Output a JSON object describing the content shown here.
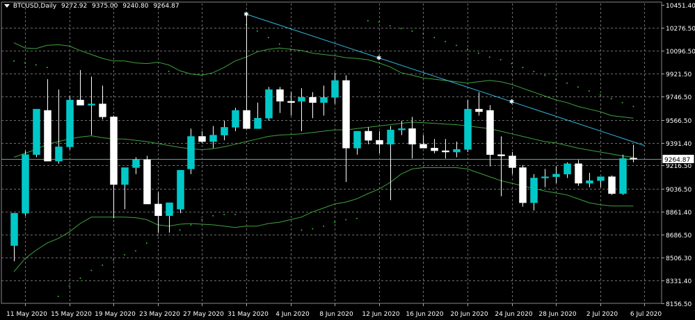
{
  "header": {
    "symbol": "BTCUSD,Daily",
    "open": "9272.92",
    "high": "9375.00",
    "low": "9240.80",
    "close": "9264.87"
  },
  "colors": {
    "background": "#000000",
    "bull_body": "#00c8c8",
    "bear_body": "#ffffff",
    "wick": "#ffffff",
    "band": "#3fa33f",
    "sar": "#33dd33",
    "trendline": "#2fb9e0",
    "grid": "#6f6f6f",
    "price_line": "#6f9f9f"
  },
  "chart_data": {
    "type": "candlestick",
    "ylim": [
      8156.5,
      10451.4
    ],
    "y_ticks": [
      "10451.40",
      "10276.50",
      "10096.50",
      "9921.50",
      "9746.50",
      "9566.50",
      "9391.40",
      "9216.50",
      "9036.50",
      "8861.40",
      "8686.50",
      "8506.30",
      "8331.40",
      "8156.50"
    ],
    "x_ticks": [
      "11 May 2020",
      "15 May 2020",
      "19 May 2020",
      "23 May 2020",
      "27 May 2020",
      "31 May 2020",
      "4 Jun 2020",
      "8 Jun 2020",
      "12 Jun 2020",
      "16 Jun 2020",
      "20 Jun 2020",
      "24 Jun 2020",
      "28 Jun 2020",
      "2 Jul 2020",
      "6 Jul 2020"
    ],
    "current_price": "9264.87",
    "candles": [
      {
        "date": "2020-05-10",
        "o": 8600,
        "h": 8780,
        "l": 8480,
        "c": 8850
      },
      {
        "date": "2020-05-11",
        "o": 8850,
        "h": 9330,
        "l": 8830,
        "c": 9300
      },
      {
        "date": "2020-05-12",
        "o": 9300,
        "h": 9600,
        "l": 9280,
        "c": 9650
      },
      {
        "date": "2020-05-13",
        "o": 9640,
        "h": 9880,
        "l": 9250,
        "c": 9250
      },
      {
        "date": "2020-05-14",
        "o": 9250,
        "h": 9800,
        "l": 9230,
        "c": 9360
      },
      {
        "date": "2020-05-15",
        "o": 9360,
        "h": 9750,
        "l": 9340,
        "c": 9720
      },
      {
        "date": "2020-05-16",
        "o": 9720,
        "h": 9950,
        "l": 9700,
        "c": 9680
      },
      {
        "date": "2020-05-17",
        "o": 9680,
        "h": 9900,
        "l": 9450,
        "c": 9690
      },
      {
        "date": "2020-05-18",
        "o": 9690,
        "h": 9830,
        "l": 9570,
        "c": 9590
      },
      {
        "date": "2020-05-19",
        "o": 9590,
        "h": 9600,
        "l": 8810,
        "c": 9070
      },
      {
        "date": "2020-05-20",
        "o": 9070,
        "h": 9200,
        "l": 8880,
        "c": 9200
      },
      {
        "date": "2020-05-21",
        "o": 9200,
        "h": 9280,
        "l": 9150,
        "c": 9260
      },
      {
        "date": "2020-05-22",
        "o": 9260,
        "h": 9290,
        "l": 8920,
        "c": 8920
      },
      {
        "date": "2020-05-23",
        "o": 8920,
        "h": 9010,
        "l": 8700,
        "c": 8830
      },
      {
        "date": "2020-05-24",
        "o": 8830,
        "h": 8920,
        "l": 8700,
        "c": 8930
      },
      {
        "date": "2020-05-25",
        "o": 8880,
        "h": 9180,
        "l": 8850,
        "c": 9180
      },
      {
        "date": "2020-05-26",
        "o": 9190,
        "h": 9500,
        "l": 9150,
        "c": 9440
      },
      {
        "date": "2020-05-27",
        "o": 9440,
        "h": 9480,
        "l": 9390,
        "c": 9400
      },
      {
        "date": "2020-05-28",
        "o": 9400,
        "h": 9520,
        "l": 9350,
        "c": 9450
      },
      {
        "date": "2020-05-29",
        "o": 9450,
        "h": 9560,
        "l": 9410,
        "c": 9510
      },
      {
        "date": "2020-05-30",
        "o": 9510,
        "h": 9660,
        "l": 9480,
        "c": 9640
      },
      {
        "date": "2020-05-31",
        "o": 9640,
        "h": 10380,
        "l": 9510,
        "c": 9500
      },
      {
        "date": "2020-06-01",
        "o": 9500,
        "h": 9700,
        "l": 9500,
        "c": 9580
      },
      {
        "date": "2020-06-02",
        "o": 9580,
        "h": 9820,
        "l": 9560,
        "c": 9800
      },
      {
        "date": "2020-06-03",
        "o": 9800,
        "h": 9820,
        "l": 9620,
        "c": 9710
      },
      {
        "date": "2020-06-04",
        "o": 9710,
        "h": 9780,
        "l": 9600,
        "c": 9700
      },
      {
        "date": "2020-06-05",
        "o": 9710,
        "h": 9810,
        "l": 9480,
        "c": 9740
      },
      {
        "date": "2020-06-06",
        "o": 9740,
        "h": 9780,
        "l": 9580,
        "c": 9700
      },
      {
        "date": "2020-06-07",
        "o": 9700,
        "h": 9830,
        "l": 9600,
        "c": 9740
      },
      {
        "date": "2020-06-08",
        "o": 9740,
        "h": 9930,
        "l": 9690,
        "c": 9870
      },
      {
        "date": "2020-06-09",
        "o": 9870,
        "h": 9910,
        "l": 9090,
        "c": 9350
      },
      {
        "date": "2020-06-10",
        "o": 9350,
        "h": 9450,
        "l": 9300,
        "c": 9480
      },
      {
        "date": "2020-06-11",
        "o": 9480,
        "h": 9510,
        "l": 9380,
        "c": 9410
      },
      {
        "date": "2020-06-12",
        "o": 9410,
        "h": 9480,
        "l": 9310,
        "c": 9380
      },
      {
        "date": "2020-06-13",
        "o": 9380,
        "h": 9520,
        "l": 8950,
        "c": 9490
      },
      {
        "date": "2020-06-14",
        "o": 9490,
        "h": 9560,
        "l": 9450,
        "c": 9500
      },
      {
        "date": "2020-06-15",
        "o": 9500,
        "h": 9590,
        "l": 9270,
        "c": 9380
      },
      {
        "date": "2020-06-16",
        "o": 9380,
        "h": 9450,
        "l": 9350,
        "c": 9350
      },
      {
        "date": "2020-06-17",
        "o": 9350,
        "h": 9420,
        "l": 9310,
        "c": 9330
      },
      {
        "date": "2020-06-18",
        "o": 9330,
        "h": 9420,
        "l": 9270,
        "c": 9320
      },
      {
        "date": "2020-06-19",
        "o": 9320,
        "h": 9400,
        "l": 9280,
        "c": 9340
      },
      {
        "date": "2020-06-20",
        "o": 9340,
        "h": 9720,
        "l": 9320,
        "c": 9650
      },
      {
        "date": "2020-06-21",
        "o": 9650,
        "h": 9780,
        "l": 9600,
        "c": 9630
      },
      {
        "date": "2020-06-22",
        "o": 9640,
        "h": 9680,
        "l": 9210,
        "c": 9300
      },
      {
        "date": "2020-06-23",
        "o": 9300,
        "h": 9440,
        "l": 8980,
        "c": 9290
      },
      {
        "date": "2020-06-24",
        "o": 9290,
        "h": 9320,
        "l": 9150,
        "c": 9200
      },
      {
        "date": "2020-06-25",
        "o": 9200,
        "h": 9220,
        "l": 8900,
        "c": 8930
      },
      {
        "date": "2020-06-26",
        "o": 8930,
        "h": 9150,
        "l": 8870,
        "c": 9120
      },
      {
        "date": "2020-06-27",
        "o": 9120,
        "h": 9190,
        "l": 9050,
        "c": 9130
      },
      {
        "date": "2020-06-28",
        "o": 9130,
        "h": 9210,
        "l": 9080,
        "c": 9150
      },
      {
        "date": "2020-06-29",
        "o": 9150,
        "h": 9240,
        "l": 9120,
        "c": 9230
      },
      {
        "date": "2020-06-30",
        "o": 9230,
        "h": 9260,
        "l": 9060,
        "c": 9080
      },
      {
        "date": "2020-07-01",
        "o": 9080,
        "h": 9160,
        "l": 9050,
        "c": 9100
      },
      {
        "date": "2020-07-02",
        "o": 9100,
        "h": 9130,
        "l": 9050,
        "c": 9130
      },
      {
        "date": "2020-07-03",
        "o": 9130,
        "h": 9140,
        "l": 8990,
        "c": 9000
      },
      {
        "date": "2020-07-04",
        "o": 9000,
        "h": 9300,
        "l": 8990,
        "c": 9270
      },
      {
        "date": "2020-07-05",
        "o": 9272.92,
        "h": 9375.0,
        "l": 9240.8,
        "c": 9264.87
      }
    ],
    "bollinger": {
      "upper": [
        10160,
        10120,
        10115,
        10140,
        10145,
        10135,
        10100,
        10070,
        10040,
        10020,
        10020,
        10005,
        10000,
        10010,
        9990,
        9945,
        9920,
        9910,
        9930,
        9970,
        10020,
        10050,
        10090,
        10110,
        10120,
        10110,
        10100,
        10080,
        10070,
        10060,
        10045,
        10040,
        10030,
        10005,
        9975,
        9930,
        9910,
        9890,
        9880,
        9870,
        9860,
        9850,
        9860,
        9870,
        9860,
        9840,
        9810,
        9780,
        9750,
        9720,
        9700,
        9670,
        9650,
        9630,
        9600,
        9590,
        9580
      ],
      "middle": [
        9280,
        9310,
        9340,
        9380,
        9400,
        9420,
        9435,
        9445,
        9430,
        9420,
        9420,
        9410,
        9400,
        9385,
        9370,
        9355,
        9345,
        9338,
        9345,
        9360,
        9380,
        9400,
        9420,
        9440,
        9450,
        9455,
        9460,
        9470,
        9480,
        9490,
        9490,
        9500,
        9510,
        9520,
        9530,
        9540,
        9550,
        9545,
        9540,
        9535,
        9530,
        9520,
        9510,
        9500,
        9480,
        9460,
        9440,
        9420,
        9400,
        9390,
        9370,
        9350,
        9335,
        9320,
        9305,
        9290,
        9280
      ],
      "lower": [
        8400,
        8500,
        8565,
        8620,
        8655,
        8705,
        8770,
        8820,
        8820,
        8820,
        8820,
        8815,
        8800,
        8760,
        8750,
        8765,
        8770,
        8765,
        8760,
        8750,
        8740,
        8750,
        8750,
        8770,
        8780,
        8800,
        8820,
        8860,
        8890,
        8920,
        8935,
        8960,
        9000,
        9035,
        9085,
        9150,
        9190,
        9200,
        9200,
        9200,
        9200,
        9190,
        9160,
        9130,
        9100,
        9080,
        9060,
        9040,
        9020,
        9005,
        8990,
        8960,
        8930,
        8915,
        8905,
        8905,
        8905
      ]
    },
    "sar": [
      {
        "i": 0,
        "v": 10020
      },
      {
        "i": 1,
        "v": 10005
      },
      {
        "i": 2,
        "v": 9990
      },
      {
        "i": 3,
        "v": 9970
      },
      {
        "i": 4,
        "v": 8210
      },
      {
        "i": 5,
        "v": 8290
      },
      {
        "i": 6,
        "v": 8350
      },
      {
        "i": 7,
        "v": 8410
      },
      {
        "i": 8,
        "v": 8450
      },
      {
        "i": 9,
        "v": 8490
      },
      {
        "i": 10,
        "v": 8530
      },
      {
        "i": 11,
        "v": 8560
      },
      {
        "i": 12,
        "v": 8620
      },
      {
        "i": 13,
        "v": 8680
      },
      {
        "i": 14,
        "v": 9940
      },
      {
        "i": 15,
        "v": 8720
      },
      {
        "i": 16,
        "v": 8760
      },
      {
        "i": 17,
        "v": 8800
      },
      {
        "i": 18,
        "v": 8830
      },
      {
        "i": 19,
        "v": 8840
      },
      {
        "i": 20,
        "v": 8840
      },
      {
        "i": 21,
        "v": 10300
      },
      {
        "i": 22,
        "v": 10250
      },
      {
        "i": 23,
        "v": 10200
      },
      {
        "i": 24,
        "v": 10150
      },
      {
        "i": 25,
        "v": 10110
      },
      {
        "i": 26,
        "v": 8720
      },
      {
        "i": 27,
        "v": 8730
      },
      {
        "i": 28,
        "v": 8750
      },
      {
        "i": 29,
        "v": 8780
      },
      {
        "i": 30,
        "v": 8800
      },
      {
        "i": 31,
        "v": 8810
      },
      {
        "i": 32,
        "v": 10330
      },
      {
        "i": 33,
        "v": 10320
      },
      {
        "i": 34,
        "v": 10290
      },
      {
        "i": 35,
        "v": 10270
      },
      {
        "i": 36,
        "v": 10250
      },
      {
        "i": 37,
        "v": 10230
      },
      {
        "i": 38,
        "v": 10200
      },
      {
        "i": 39,
        "v": 10170
      },
      {
        "i": 40,
        "v": 10140
      },
      {
        "i": 41,
        "v": 10110
      },
      {
        "i": 42,
        "v": 10080
      },
      {
        "i": 43,
        "v": 10050
      },
      {
        "i": 44,
        "v": 10030
      },
      {
        "i": 45,
        "v": 10000
      },
      {
        "i": 46,
        "v": 9970
      },
      {
        "i": 47,
        "v": 9940
      },
      {
        "i": 48,
        "v": 9910
      },
      {
        "i": 49,
        "v": 9880
      },
      {
        "i": 50,
        "v": 9850
      },
      {
        "i": 51,
        "v": 9820
      },
      {
        "i": 52,
        "v": 9790
      },
      {
        "i": 53,
        "v": 9760
      },
      {
        "i": 54,
        "v": 9730
      },
      {
        "i": 55,
        "v": 9700
      },
      {
        "i": 56,
        "v": 9670
      }
    ],
    "trendline": {
      "x1": 21,
      "y1": 10380,
      "x2": 57,
      "y2": 9370,
      "markers": [
        21,
        33,
        45
      ]
    }
  }
}
